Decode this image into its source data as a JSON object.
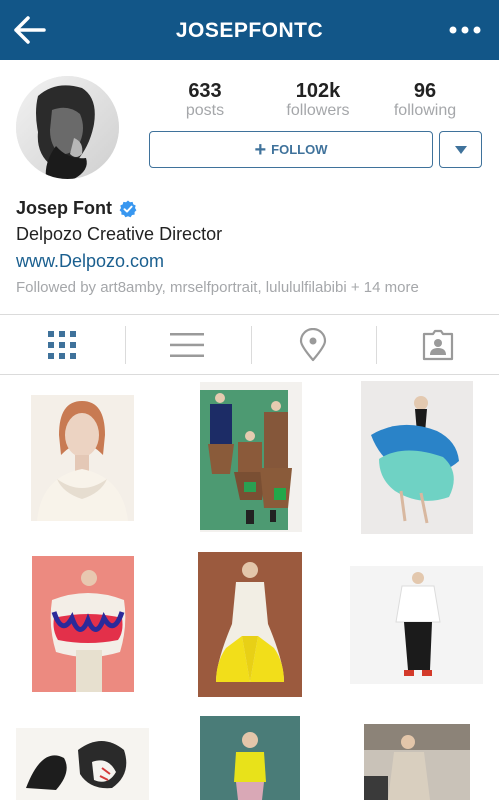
{
  "header": {
    "username": "JOSEPFONTC",
    "back_icon": "back-arrow-icon",
    "menu_icon": "more-options-icon",
    "bar_color": "#125688"
  },
  "profile": {
    "stats": [
      {
        "value": "633",
        "label": "posts"
      },
      {
        "value": "102k",
        "label": "followers"
      },
      {
        "value": "96",
        "label": "following"
      }
    ],
    "follow_label": "FOLLOW",
    "name": "Josep Font",
    "bio": "Delpozo Creative Director",
    "website": "www.Delpozo.com",
    "followed_by": "Followed by art8amby, mrselfportrait, lulululfilabibi + 14 more",
    "accent_color": "#3f729b",
    "link_color": "#1a5f8f"
  },
  "tabs": [
    {
      "name": "grid-view",
      "icon": "grid-icon",
      "active": true
    },
    {
      "name": "list-view",
      "icon": "list-icon",
      "active": false
    },
    {
      "name": "map-view",
      "icon": "location-pin-icon",
      "active": false
    },
    {
      "name": "tagged-view",
      "icon": "tagged-person-icon",
      "active": false
    }
  ],
  "grid_items": [
    {
      "icon": "portrait-photo"
    },
    {
      "icon": "fashion-group-photo"
    },
    {
      "icon": "tulle-dress-photo"
    },
    {
      "icon": "ruffle-top-photo"
    },
    {
      "icon": "yellow-dress-photo"
    },
    {
      "icon": "white-top-photo"
    },
    {
      "icon": "illustration-photo"
    },
    {
      "icon": "yellow-top-photo"
    },
    {
      "icon": "street-style-photo"
    }
  ]
}
